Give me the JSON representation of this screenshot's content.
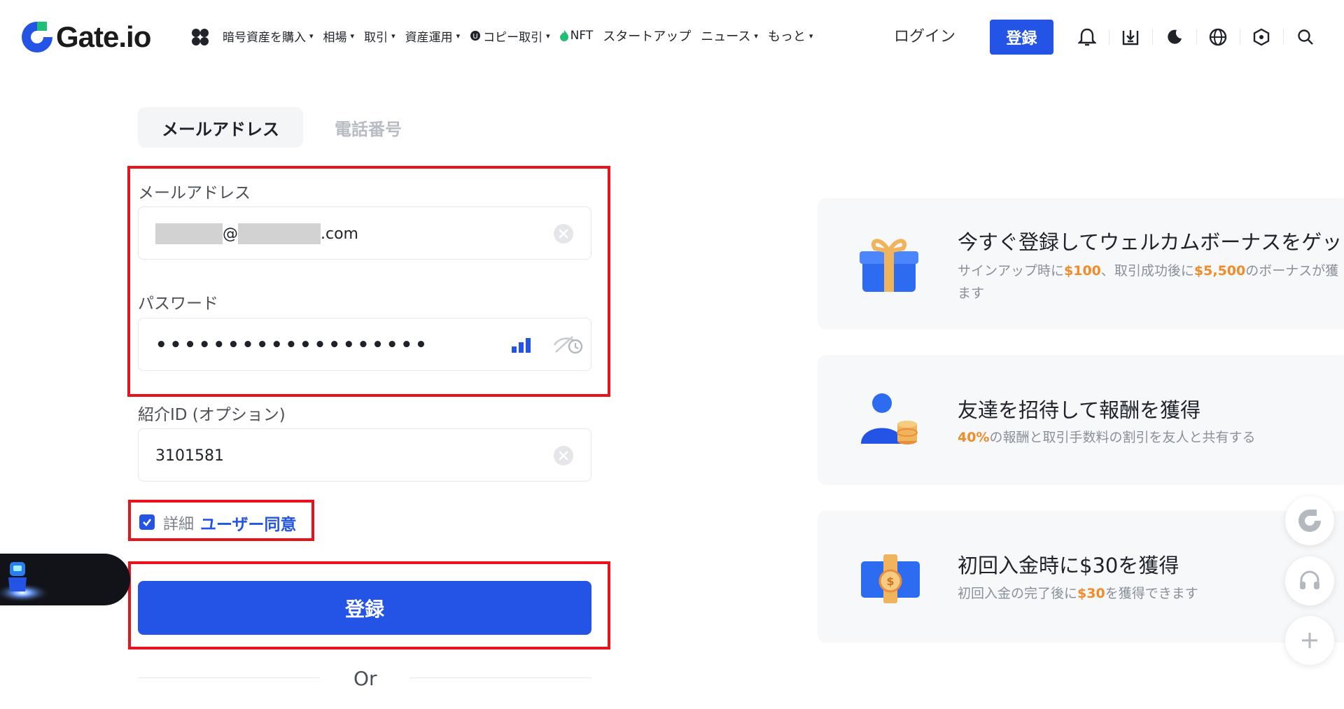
{
  "header": {
    "logo_text": "Gate.io",
    "nav": [
      {
        "label": "暗号資産を購入",
        "caret": "▾"
      },
      {
        "label": "相場",
        "caret": "▾"
      },
      {
        "label": "取引",
        "caret": "▾"
      },
      {
        "label": "資産運用",
        "caret": "▾"
      },
      {
        "label": "コピー取引",
        "caret": "▾"
      },
      {
        "label": "NFT"
      },
      {
        "label": "スタートアップ"
      },
      {
        "label": "ニュース",
        "caret": "▾"
      },
      {
        "label": "もっと",
        "caret": "▾"
      }
    ],
    "login_label": "ログイン",
    "register_label": "登録",
    "icons": [
      "bell-icon",
      "download-icon",
      "moon-icon",
      "globe-icon",
      "settings-icon",
      "search-icon"
    ]
  },
  "tabs": {
    "email": "メールアドレス",
    "phone": "電話番号"
  },
  "form": {
    "email_label": "メールアドレス",
    "email_at": "@",
    "email_suffix": ".com",
    "password_label": "パスワード",
    "password_value": "•••••••••••••••••••",
    "referral_label": "紹介ID (オプション)",
    "referral_value": "3101581",
    "agree_prefix": "詳細",
    "agree_link": "ユーザー同意",
    "checkbox_checked": true,
    "submit_label": "登録",
    "or_label": "Or"
  },
  "promos": [
    {
      "title": "今すぐ登録してウェルカムボーナスをゲッ",
      "desc_line1_a": "サインアップ時に",
      "desc_line1_b": "$100",
      "desc_line1_c": "、取引成功後に",
      "desc_line1_d": "$5,500",
      "desc_line1_e": "のボーナスが獲",
      "desc_line2": "ます"
    },
    {
      "title": "友達を招待して報酬を獲得",
      "desc_a": "40%",
      "desc_b": "の報酬と取引手数料の割引を友人と共有する"
    },
    {
      "title": "初回入金時に$30を獲得",
      "desc_a": "初回入金の完了後に",
      "desc_b": "$30",
      "desc_c": "を獲得できます"
    }
  ],
  "colors": {
    "brand_blue": "#2354e6",
    "highlight_red": "#e8141d",
    "accent_orange": "#f28b2a",
    "nft_green": "#1fbf75"
  }
}
